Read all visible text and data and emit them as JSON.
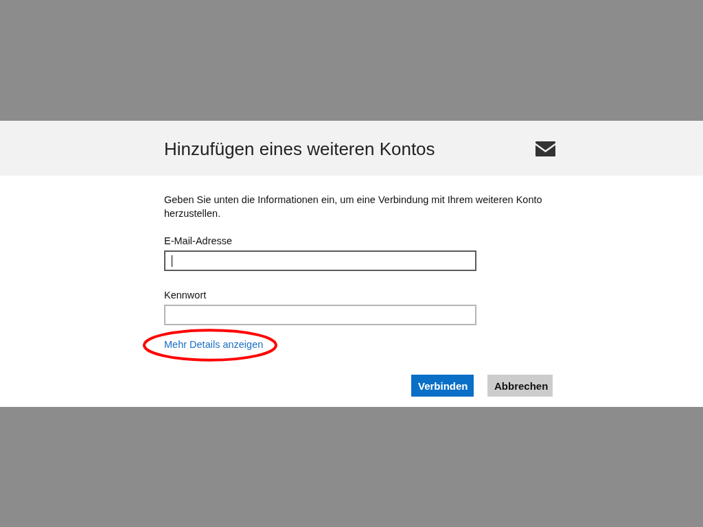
{
  "dialog": {
    "title": "Hinzufügen eines weiteren Kontos",
    "description": "Geben Sie unten die Informationen ein, um eine Verbindung mit Ihrem weiteren Konto herzustellen.",
    "fields": [
      {
        "label": "E-Mail-Adresse",
        "focused": true
      },
      {
        "label": "Kennwort",
        "focused": false
      }
    ],
    "link": {
      "text": "Mehr Details anzeigen",
      "circled": true
    },
    "buttons": [
      {
        "label": "Verbinden",
        "kind": "primary"
      },
      {
        "label": "Abbrechen",
        "kind": "secondary"
      }
    ]
  }
}
